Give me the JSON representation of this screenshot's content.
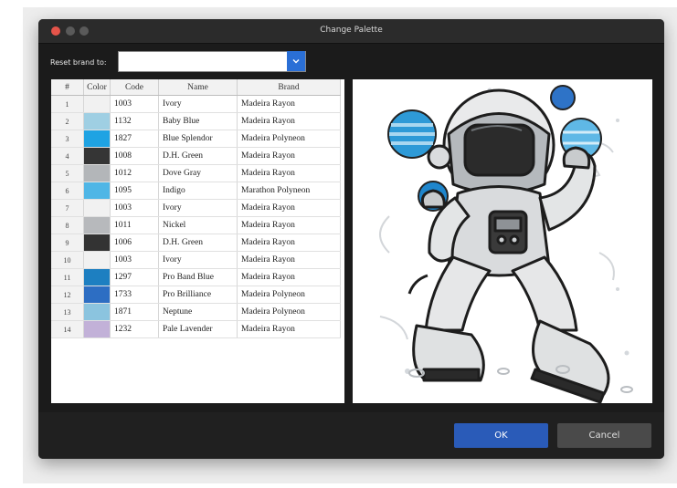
{
  "window": {
    "title": "Change Palette"
  },
  "reset": {
    "label": "Reset brand to:",
    "value": ""
  },
  "table": {
    "headers": [
      "#",
      "Color",
      "Code",
      "Name",
      "Brand"
    ],
    "rows": [
      {
        "num": "1",
        "color": "#f1f1f1",
        "code": "1003",
        "name": "Ivory",
        "brand": "Madeira Rayon"
      },
      {
        "num": "2",
        "color": "#9fcfe3",
        "code": "1132",
        "name": "Baby Blue",
        "brand": "Madeira Rayon"
      },
      {
        "num": "3",
        "color": "#1fa3e3",
        "code": "1827",
        "name": "Blue Splendor",
        "brand": "Madeira Polyneon"
      },
      {
        "num": "4",
        "color": "#353535",
        "code": "1008",
        "name": "D.H. Green",
        "brand": "Madeira Rayon"
      },
      {
        "num": "5",
        "color": "#b3b6b9",
        "code": "1012",
        "name": "Dove Gray",
        "brand": "Madeira Rayon"
      },
      {
        "num": "6",
        "color": "#4fb6e6",
        "code": "1095",
        "name": "Indigo",
        "brand": "Marathon Polyneon"
      },
      {
        "num": "7",
        "color": "#f1f1f1",
        "code": "1003",
        "name": "Ivory",
        "brand": "Madeira Rayon"
      },
      {
        "num": "8",
        "color": "#b7b9bc",
        "code": "1011",
        "name": "Nickel",
        "brand": "Madeira Rayon"
      },
      {
        "num": "9",
        "color": "#333333",
        "code": "1006",
        "name": "D.H. Green",
        "brand": "Madeira Rayon"
      },
      {
        "num": "10",
        "color": "#f1f1f1",
        "code": "1003",
        "name": "Ivory",
        "brand": "Madeira Rayon"
      },
      {
        "num": "11",
        "color": "#1d7fc1",
        "code": "1297",
        "name": "Pro Band Blue",
        "brand": "Madeira Rayon"
      },
      {
        "num": "12",
        "color": "#2d6ec3",
        "code": "1733",
        "name": "Pro Brilliance",
        "brand": "Madeira Polyneon"
      },
      {
        "num": "13",
        "color": "#8bc4df",
        "code": "1871",
        "name": "Neptune",
        "brand": "Madeira Polyneon"
      },
      {
        "num": "14",
        "color": "#c2b1d8",
        "code": "1232",
        "name": "Pale Lavender",
        "brand": "Madeira Rayon"
      }
    ]
  },
  "buttons": {
    "ok": "OK",
    "cancel": "Cancel"
  },
  "icons": {
    "dropdown": "chevron-down-icon"
  },
  "colors": {
    "accent": "#2a5bb8",
    "dropdown_button": "#2a6fd6",
    "close_dot": "#e5544a"
  }
}
